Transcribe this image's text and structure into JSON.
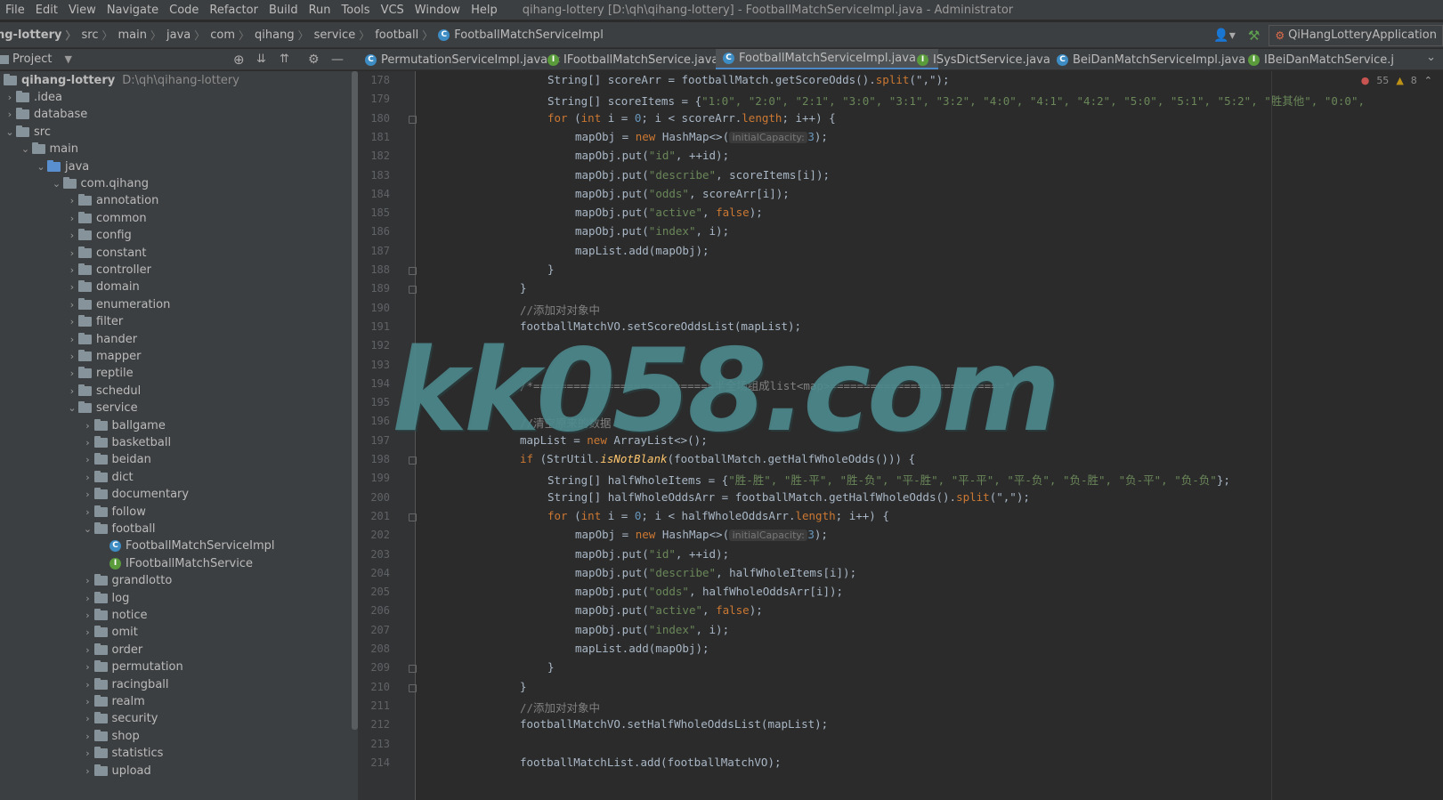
{
  "menu": {
    "items": [
      "File",
      "Edit",
      "View",
      "Navigate",
      "Code",
      "Refactor",
      "Build",
      "Run",
      "Tools",
      "VCS",
      "Window",
      "Help"
    ],
    "window_title": "qihang-lottery [D:\\qh\\qihang-lottery] - FootballMatchServiceImpl.java - Administrator"
  },
  "breadcrumb": [
    "ng-lottery",
    "src",
    "main",
    "java",
    "com",
    "qihang",
    "service",
    "football",
    "FootballMatchServiceImpl"
  ],
  "run_config": "QiHangLotteryApplication",
  "project_panel": {
    "title": "Project",
    "root_name": "qihang-lottery",
    "root_path": "D:\\qh\\qihang-lottery",
    "tree": [
      {
        "label": ".idea",
        "arrow": "›",
        "kind": "folder",
        "depth": 0
      },
      {
        "label": "database",
        "arrow": "›",
        "kind": "folder",
        "depth": 0
      },
      {
        "label": "src",
        "arrow": "⌄",
        "kind": "folder",
        "depth": 0
      },
      {
        "label": "main",
        "arrow": "⌄",
        "kind": "folder",
        "depth": 1
      },
      {
        "label": "java",
        "arrow": "⌄",
        "kind": "src",
        "depth": 2
      },
      {
        "label": "com.qihang",
        "arrow": "⌄",
        "kind": "folder",
        "depth": 3
      },
      {
        "label": "annotation",
        "arrow": "›",
        "kind": "folder",
        "depth": 4
      },
      {
        "label": "common",
        "arrow": "›",
        "kind": "folder",
        "depth": 4
      },
      {
        "label": "config",
        "arrow": "›",
        "kind": "folder",
        "depth": 4
      },
      {
        "label": "constant",
        "arrow": "›",
        "kind": "folder",
        "depth": 4
      },
      {
        "label": "controller",
        "arrow": "›",
        "kind": "folder",
        "depth": 4
      },
      {
        "label": "domain",
        "arrow": "›",
        "kind": "folder",
        "depth": 4
      },
      {
        "label": "enumeration",
        "arrow": "›",
        "kind": "folder",
        "depth": 4
      },
      {
        "label": "filter",
        "arrow": "›",
        "kind": "folder",
        "depth": 4
      },
      {
        "label": "hander",
        "arrow": "›",
        "kind": "folder",
        "depth": 4
      },
      {
        "label": "mapper",
        "arrow": "›",
        "kind": "folder",
        "depth": 4
      },
      {
        "label": "reptile",
        "arrow": "›",
        "kind": "folder",
        "depth": 4
      },
      {
        "label": "schedul",
        "arrow": "›",
        "kind": "folder",
        "depth": 4
      },
      {
        "label": "service",
        "arrow": "⌄",
        "kind": "folder",
        "depth": 4
      },
      {
        "label": "ballgame",
        "arrow": "›",
        "kind": "folder",
        "depth": 5
      },
      {
        "label": "basketball",
        "arrow": "›",
        "kind": "folder",
        "depth": 5
      },
      {
        "label": "beidan",
        "arrow": "›",
        "kind": "folder",
        "depth": 5
      },
      {
        "label": "dict",
        "arrow": "›",
        "kind": "folder",
        "depth": 5
      },
      {
        "label": "documentary",
        "arrow": "›",
        "kind": "folder",
        "depth": 5
      },
      {
        "label": "follow",
        "arrow": "›",
        "kind": "folder",
        "depth": 5
      },
      {
        "label": "football",
        "arrow": "⌄",
        "kind": "folder",
        "depth": 5
      },
      {
        "label": "FootballMatchServiceImpl",
        "arrow": "",
        "kind": "class",
        "depth": 6
      },
      {
        "label": "IFootballMatchService",
        "arrow": "",
        "kind": "interface",
        "depth": 6
      },
      {
        "label": "grandlotto",
        "arrow": "›",
        "kind": "folder",
        "depth": 5
      },
      {
        "label": "log",
        "arrow": "›",
        "kind": "folder",
        "depth": 5
      },
      {
        "label": "notice",
        "arrow": "›",
        "kind": "folder",
        "depth": 5
      },
      {
        "label": "omit",
        "arrow": "›",
        "kind": "folder",
        "depth": 5
      },
      {
        "label": "order",
        "arrow": "›",
        "kind": "folder",
        "depth": 5
      },
      {
        "label": "permutation",
        "arrow": "›",
        "kind": "folder",
        "depth": 5
      },
      {
        "label": "racingball",
        "arrow": "›",
        "kind": "folder",
        "depth": 5
      },
      {
        "label": "realm",
        "arrow": "›",
        "kind": "folder",
        "depth": 5
      },
      {
        "label": "security",
        "arrow": "›",
        "kind": "folder",
        "depth": 5
      },
      {
        "label": "shop",
        "arrow": "›",
        "kind": "folder",
        "depth": 5
      },
      {
        "label": "statistics",
        "arrow": "›",
        "kind": "folder",
        "depth": 5
      },
      {
        "label": "upload",
        "arrow": "›",
        "kind": "folder",
        "depth": 5
      }
    ]
  },
  "tabs": [
    {
      "label": "PermutationServiceImpl.java",
      "kind": "class",
      "active": false
    },
    {
      "label": "IFootballMatchService.java",
      "kind": "interface",
      "active": false
    },
    {
      "label": "FootballMatchServiceImpl.java",
      "kind": "class",
      "active": true
    },
    {
      "label": "ISysDictService.java",
      "kind": "interface",
      "active": false
    },
    {
      "label": "BeiDanMatchServiceImpl.java",
      "kind": "class",
      "active": false
    },
    {
      "label": "IBeiDanMatchService.j",
      "kind": "interface",
      "active": false
    }
  ],
  "inspection": {
    "errors": "55",
    "warnings": "8"
  },
  "colors": {
    "keyword": "#cc7832",
    "string": "#6a8759",
    "number": "#6897bb",
    "comment": "#808080",
    "method_static": "#ffc66d",
    "default": "#a9b7c6",
    "hint": "#787878"
  },
  "code": {
    "first_line": 178,
    "lines": [
      {
        "indent": 1,
        "segs": [
          [
            "String[] scoreArr = footballMatch.getScoreOdds().",
            "d"
          ],
          [
            "split",
            "k"
          ],
          [
            "(\",\");",
            "d"
          ]
        ]
      },
      {
        "indent": 1,
        "segs": [
          [
            "String[] scoreItems = {",
            "d"
          ],
          [
            "\"1:0\", \"2:0\", \"2:1\", \"3:0\", \"3:1\", \"3:2\", \"4:0\", \"4:1\", \"4:2\", \"5:0\", \"5:1\", \"5:2\", \"胜其他\", \"0:0\",",
            "s"
          ]
        ]
      },
      {
        "indent": 1,
        "segs": [
          [
            "for",
            "k"
          ],
          [
            " (",
            "d"
          ],
          [
            "int",
            "k"
          ],
          [
            " i = ",
            "d"
          ],
          [
            "0",
            "n"
          ],
          [
            "; i < scoreArr.",
            "d"
          ],
          [
            "length",
            "k"
          ],
          [
            "; i++) {",
            "d"
          ]
        ]
      },
      {
        "indent": 2,
        "segs": [
          [
            "mapObj = ",
            "d"
          ],
          [
            "new",
            "k"
          ],
          [
            " HashMap<>(",
            "d"
          ],
          [
            " initialCapacity: ",
            "h"
          ],
          [
            "3",
            "n"
          ],
          [
            ");",
            "d"
          ]
        ]
      },
      {
        "indent": 2,
        "segs": [
          [
            "mapObj.put(",
            "d"
          ],
          [
            "\"id\"",
            "s"
          ],
          [
            ", ++id);",
            "d"
          ]
        ]
      },
      {
        "indent": 2,
        "segs": [
          [
            "mapObj.put(",
            "d"
          ],
          [
            "\"describe\"",
            "s"
          ],
          [
            ", scoreItems[i]);",
            "d"
          ]
        ]
      },
      {
        "indent": 2,
        "segs": [
          [
            "mapObj.put(",
            "d"
          ],
          [
            "\"odds\"",
            "s"
          ],
          [
            ", scoreArr[i]);",
            "d"
          ]
        ]
      },
      {
        "indent": 2,
        "segs": [
          [
            "mapObj.put(",
            "d"
          ],
          [
            "\"active\"",
            "s"
          ],
          [
            ", ",
            "d"
          ],
          [
            "false",
            "k"
          ],
          [
            ");",
            "d"
          ]
        ]
      },
      {
        "indent": 2,
        "segs": [
          [
            "mapObj.put(",
            "d"
          ],
          [
            "\"index\"",
            "s"
          ],
          [
            ", i);",
            "d"
          ]
        ]
      },
      {
        "indent": 2,
        "segs": [
          [
            "mapList.add(mapObj);",
            "d"
          ]
        ]
      },
      {
        "indent": 1,
        "segs": [
          [
            "}",
            "d"
          ]
        ]
      },
      {
        "indent": 0,
        "segs": [
          [
            "}",
            "d"
          ]
        ]
      },
      {
        "indent": 0,
        "segs": [
          [
            "//添加对对象中",
            "c"
          ]
        ]
      },
      {
        "indent": 0,
        "segs": [
          [
            "footballMatchVO.setScoreOddsList(mapList);",
            "d"
          ]
        ]
      },
      {
        "indent": 0,
        "segs": [
          [
            "",
            "d"
          ]
        ]
      },
      {
        "indent": 0,
        "segs": [
          [
            "",
            "d"
          ]
        ]
      },
      {
        "indent": 0,
        "segs": [
          [
            "/*===========================半全场组成list<map>==========================*/",
            "c"
          ]
        ]
      },
      {
        "indent": 0,
        "segs": [
          [
            "",
            "d"
          ]
        ]
      },
      {
        "indent": 0,
        "segs": [
          [
            "//清空原来的数据",
            "c"
          ]
        ]
      },
      {
        "indent": 0,
        "segs": [
          [
            "mapList = ",
            "d"
          ],
          [
            "new",
            "k"
          ],
          [
            " ArrayList<>();",
            "d"
          ]
        ]
      },
      {
        "indent": 0,
        "segs": [
          [
            "if",
            "k"
          ],
          [
            " (StrUtil.",
            "d"
          ],
          [
            "isNotBlank",
            "m"
          ],
          [
            "(footballMatch.getHalfWholeOdds())) {",
            "d"
          ]
        ]
      },
      {
        "indent": 1,
        "segs": [
          [
            "String[] halfWholeItems = {",
            "d"
          ],
          [
            "\"胜-胜\", \"胜-平\", \"胜-负\", \"平-胜\", \"平-平\", \"平-负\", \"负-胜\", \"负-平\", \"负-负\"",
            "s"
          ],
          [
            "};",
            "d"
          ]
        ]
      },
      {
        "indent": 1,
        "segs": [
          [
            "String[] halfWholeOddsArr = footballMatch.getHalfWholeOdds().",
            "d"
          ],
          [
            "split",
            "k"
          ],
          [
            "(\",\");",
            "d"
          ]
        ]
      },
      {
        "indent": 1,
        "segs": [
          [
            "for",
            "k"
          ],
          [
            " (",
            "d"
          ],
          [
            "int",
            "k"
          ],
          [
            " i = ",
            "d"
          ],
          [
            "0",
            "n"
          ],
          [
            "; i < halfWholeOddsArr.",
            "d"
          ],
          [
            "length",
            "k"
          ],
          [
            "; i++) {",
            "d"
          ]
        ]
      },
      {
        "indent": 2,
        "segs": [
          [
            "mapObj = ",
            "d"
          ],
          [
            "new",
            "k"
          ],
          [
            " HashMap<>(",
            "d"
          ],
          [
            " initialCapacity: ",
            "h"
          ],
          [
            "3",
            "n"
          ],
          [
            ");",
            "d"
          ]
        ]
      },
      {
        "indent": 2,
        "segs": [
          [
            "mapObj.put(",
            "d"
          ],
          [
            "\"id\"",
            "s"
          ],
          [
            ", ++id);",
            "d"
          ]
        ]
      },
      {
        "indent": 2,
        "segs": [
          [
            "mapObj.put(",
            "d"
          ],
          [
            "\"describe\"",
            "s"
          ],
          [
            ", halfWholeItems[i]);",
            "d"
          ]
        ]
      },
      {
        "indent": 2,
        "segs": [
          [
            "mapObj.put(",
            "d"
          ],
          [
            "\"odds\"",
            "s"
          ],
          [
            ", halfWholeOddsArr[i]);",
            "d"
          ]
        ]
      },
      {
        "indent": 2,
        "segs": [
          [
            "mapObj.put(",
            "d"
          ],
          [
            "\"active\"",
            "s"
          ],
          [
            ", ",
            "d"
          ],
          [
            "false",
            "k"
          ],
          [
            ");",
            "d"
          ]
        ]
      },
      {
        "indent": 2,
        "segs": [
          [
            "mapObj.put(",
            "d"
          ],
          [
            "\"index\"",
            "s"
          ],
          [
            ", i);",
            "d"
          ]
        ]
      },
      {
        "indent": 2,
        "segs": [
          [
            "mapList.add(mapObj);",
            "d"
          ]
        ]
      },
      {
        "indent": 1,
        "segs": [
          [
            "}",
            "d"
          ]
        ]
      },
      {
        "indent": 0,
        "segs": [
          [
            "}",
            "d"
          ]
        ]
      },
      {
        "indent": 0,
        "segs": [
          [
            "//添加对对象中",
            "c"
          ]
        ]
      },
      {
        "indent": 0,
        "segs": [
          [
            "footballMatchVO.setHalfWholeOddsList(mapList);",
            "d"
          ]
        ]
      },
      {
        "indent": 0,
        "segs": [
          [
            "",
            "d"
          ]
        ]
      },
      {
        "indent": 0,
        "segs": [
          [
            "footballMatchList.add(footballMatchVO);",
            "d"
          ]
        ]
      }
    ]
  },
  "watermark": "kk058.com"
}
